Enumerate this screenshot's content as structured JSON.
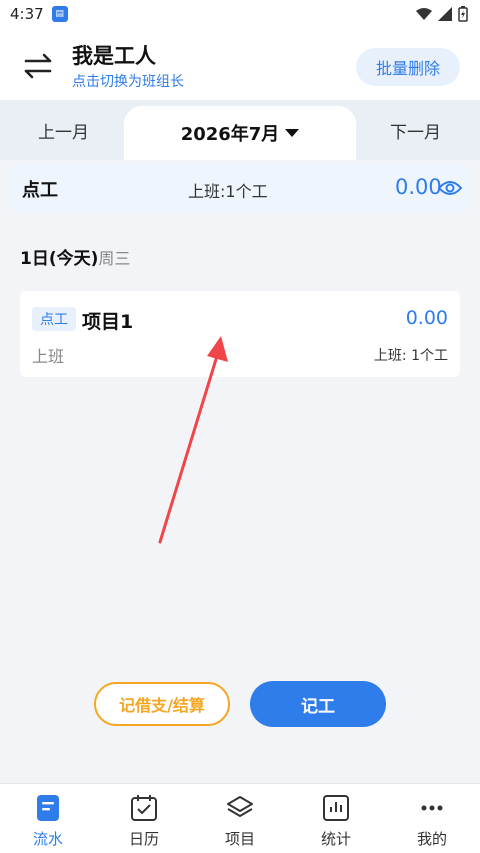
{
  "status_bar": {
    "time": "4:37"
  },
  "header": {
    "title": "我是工人",
    "subtitle": "点击切换为班组长",
    "batch_delete": "批量删除"
  },
  "month_bar": {
    "prev": "上一月",
    "current": "2026年7月",
    "next": "下一月"
  },
  "summary": {
    "type": "点工",
    "info": "上班:1个工",
    "amount": "0.00"
  },
  "day": {
    "date": "1日(今天)",
    "weekday": "周三"
  },
  "record": {
    "tag": "点工",
    "project": "项目1",
    "amount": "0.00",
    "shift": "上班",
    "detail": "上班: 1个工"
  },
  "actions": {
    "borrow": "记借支/结算",
    "record": "记工"
  },
  "bottom_nav": [
    {
      "label": "流水",
      "icon": "document-icon",
      "active": true
    },
    {
      "label": "日历",
      "icon": "calendar-check-icon",
      "active": false
    },
    {
      "label": "项目",
      "icon": "layers-icon",
      "active": false
    },
    {
      "label": "统计",
      "icon": "chart-icon",
      "active": false
    },
    {
      "label": "我的",
      "icon": "more-icon",
      "active": false
    }
  ],
  "colors": {
    "accent": "#2f7dea",
    "orange": "#f5a623",
    "arrow": "#f0464a"
  }
}
